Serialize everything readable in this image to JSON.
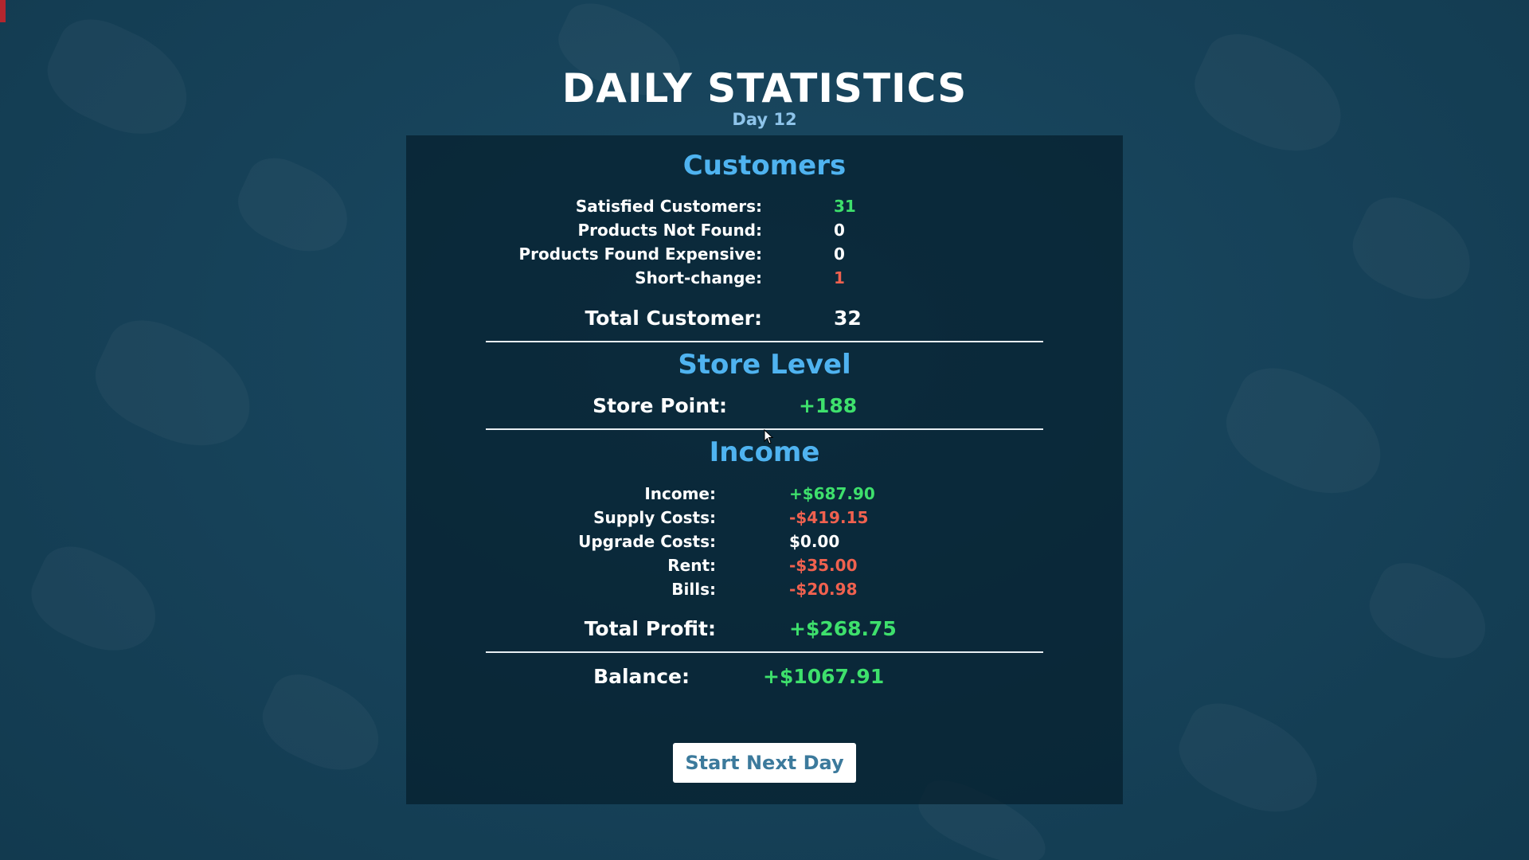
{
  "header": {
    "title": "DAILY STATISTICS",
    "day": "Day 12"
  },
  "customers": {
    "title": "Customers",
    "rows": [
      {
        "label": "Satisfied Customers:",
        "value": "31",
        "color": "#3ee06c"
      },
      {
        "label": "Products Not Found:",
        "value": "0",
        "color": "#ffffff"
      },
      {
        "label": "Products Found Expensive:",
        "value": "0",
        "color": "#ffffff"
      },
      {
        "label": "Short-change:",
        "value": "1",
        "color": "#f0614f"
      }
    ],
    "total_label": "Total Customer:",
    "total_value": "32"
  },
  "store_level": {
    "title": "Store Level",
    "point_label": "Store Point:",
    "point_value": "+188"
  },
  "income": {
    "title": "Income",
    "rows": [
      {
        "label": "Income:",
        "value": "+$687.90",
        "color": "#3ee06c"
      },
      {
        "label": "Supply Costs:",
        "value": "-$419.15",
        "color": "#f0614f"
      },
      {
        "label": "Upgrade Costs:",
        "value": "$0.00",
        "color": "#ffffff"
      },
      {
        "label": "Rent:",
        "value": "-$35.00",
        "color": "#f0614f"
      },
      {
        "label": "Bills:",
        "value": "-$20.98",
        "color": "#f0614f"
      }
    ],
    "total_label": "Total Profit:",
    "total_value": "+$268.75"
  },
  "balance": {
    "label": "Balance:",
    "value": "+$1067.91"
  },
  "actions": {
    "next_day_label": "Start Next Day"
  },
  "colors": {
    "accent_blue": "#4fb3f0",
    "positive": "#3ee06c",
    "negative": "#f0614f"
  }
}
